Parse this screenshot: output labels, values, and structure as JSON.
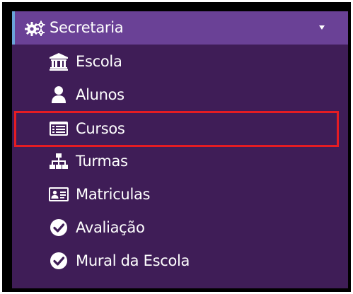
{
  "section": {
    "title": "Secretaria",
    "icon": "gears-icon",
    "toggle_icon": "caret-down-icon"
  },
  "items": [
    {
      "label": "Escola",
      "icon": "institution-icon"
    },
    {
      "label": "Alunos",
      "icon": "user-icon"
    },
    {
      "label": "Cursos",
      "icon": "list-alt-icon"
    },
    {
      "label": "Turmas",
      "icon": "sitemap-icon"
    },
    {
      "label": "Matriculas",
      "icon": "id-card-icon"
    },
    {
      "label": "Avaliação",
      "icon": "check-circle-icon"
    },
    {
      "label": "Mural da Escola",
      "icon": "check-circle-icon"
    }
  ],
  "colors": {
    "sidebar_bg": "#3f1d57",
    "header_bg": "#6a4196",
    "header_accent": "#6aa3d8",
    "text": "#ffffff",
    "highlight": "#e51c23",
    "frame": "#000000"
  },
  "highlighted_item": "Cursos"
}
